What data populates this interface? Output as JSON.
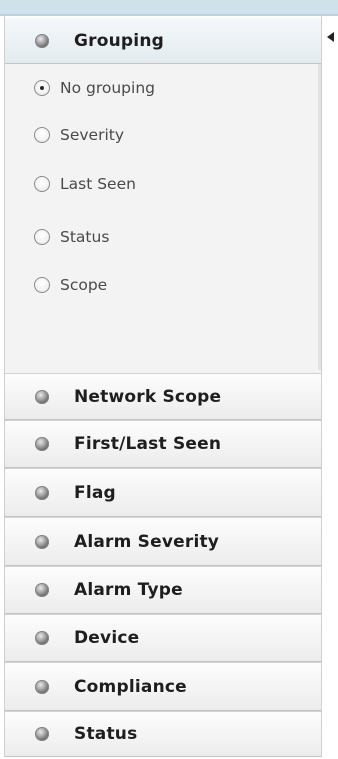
{
  "groupby": {
    "title": "Grouping",
    "options": [
      {
        "label": "No grouping",
        "checked": true
      },
      {
        "label": "Severity",
        "checked": false
      },
      {
        "label": "Last Seen",
        "checked": false
      },
      {
        "label": "Status",
        "checked": false
      },
      {
        "label": "Scope",
        "checked": false
      }
    ]
  },
  "sections": [
    {
      "label": "Network Scope"
    },
    {
      "label": "First/Last Seen"
    },
    {
      "label": "Flag"
    },
    {
      "label": "Alarm Severity"
    },
    {
      "label": "Alarm Type"
    },
    {
      "label": "Device"
    },
    {
      "label": "Compliance"
    },
    {
      "label": "Status"
    }
  ],
  "icons": {
    "bullet": "section-bullet-icon",
    "collapse": "collapse-panel-icon"
  }
}
